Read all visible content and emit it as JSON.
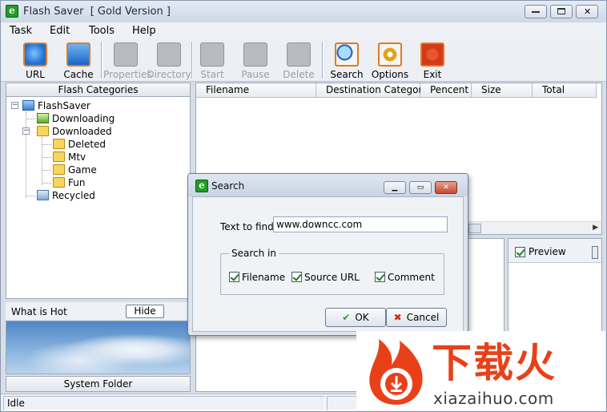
{
  "window": {
    "title": "Flash Saver  [ Gold Version ]",
    "app_icon_glyph": "e",
    "controls": [
      "minimize",
      "maximize",
      "close"
    ]
  },
  "menu": [
    "Task",
    "Edit",
    "Tools",
    "Help"
  ],
  "toolbar": {
    "buttons": [
      {
        "label": "URL",
        "icon": "ie-globe-icon",
        "enabled": true
      },
      {
        "label": "Cache",
        "icon": "cache-disk-icon",
        "enabled": true
      },
      {
        "label": "Properties",
        "icon": "properties-icon",
        "enabled": false
      },
      {
        "label": "Directory",
        "icon": "directory-icon",
        "enabled": false
      },
      {
        "label": "Start",
        "icon": "start-download-icon",
        "enabled": false
      },
      {
        "label": "Pause",
        "icon": "pause-download-icon",
        "enabled": false
      },
      {
        "label": "Delete",
        "icon": "delete-download-icon",
        "enabled": false
      },
      {
        "label": "Search",
        "icon": "search-magnifier-icon",
        "enabled": true
      },
      {
        "label": "Options",
        "icon": "options-gear-icon",
        "enabled": true
      },
      {
        "label": "Exit",
        "icon": "exit-power-icon",
        "enabled": true
      }
    ]
  },
  "categories": {
    "header": "Flash Categories",
    "tree": [
      {
        "label": "FlashSaver",
        "icon": "computer-icon"
      },
      {
        "label": "Downloading",
        "icon": "downloading-icon"
      },
      {
        "label": "Downloaded",
        "icon": "downloaded-folder-icon"
      },
      {
        "label": "Deleted",
        "icon": "folder-icon"
      },
      {
        "label": "Mtv",
        "icon": "folder-icon"
      },
      {
        "label": "Game",
        "icon": "folder-icon"
      },
      {
        "label": "Fun",
        "icon": "folder-icon"
      },
      {
        "label": "Recycled",
        "icon": "recycle-bin-icon"
      }
    ]
  },
  "what_is_hot": {
    "label": "What is Hot",
    "hide_button": "Hide"
  },
  "system_folder": "System Folder",
  "list": {
    "columns": [
      "Filename",
      "Destination Category",
      "Pencent",
      "Size",
      "Total"
    ]
  },
  "preview": {
    "label": "Preview",
    "checked": true
  },
  "status": {
    "text": "Idle"
  },
  "search_dialog": {
    "title": "Search",
    "text_to_find_label": "Text to find",
    "text_to_find_value": "www.downcc.com",
    "search_in_label": "Search in",
    "options": [
      {
        "label": "Filename",
        "checked": true
      },
      {
        "label": "Source URL",
        "checked": true
      },
      {
        "label": "Comment",
        "checked": true
      }
    ],
    "ok_label": "OK",
    "cancel_label": "Cancel"
  },
  "watermark": {
    "brand_cn": "下载火",
    "url": "xiazaihuo.com",
    "brand_color": "#e8411a"
  },
  "colors": {
    "chrome": "#d9dee6",
    "accent_green": "#1f9e22",
    "close_red": "#c44a2f"
  }
}
